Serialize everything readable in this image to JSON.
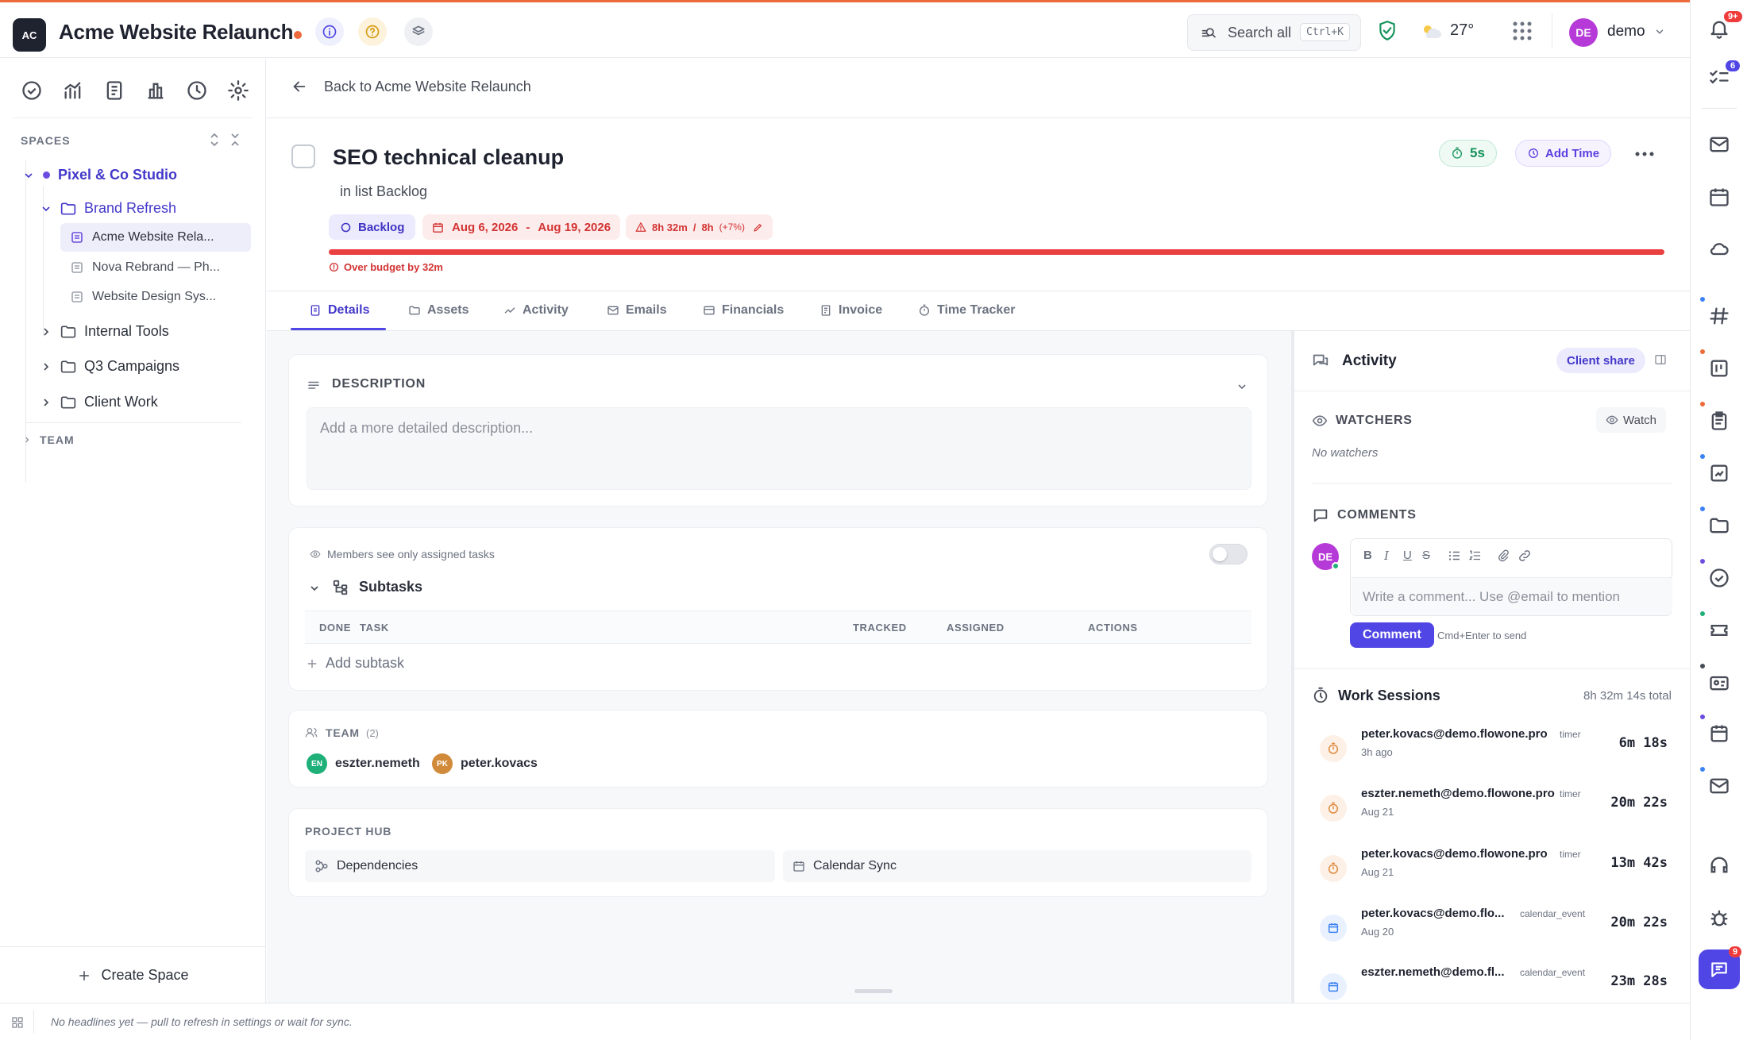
{
  "app": {
    "logo_initials": "AC",
    "project_title": "Acme Website Relaunch",
    "search_label": "Search all",
    "search_shortcut": "Ctrl+K",
    "weather_temp": "27°",
    "user_initials": "DE",
    "user_name": "demo",
    "notification_count": "9+",
    "tasks_count": "6",
    "chat_count": "9",
    "accent_color": "#4f46e5",
    "brand_orange": "#ef6a3a"
  },
  "sidebar": {
    "spaces_label": "SPACES",
    "space_name": "Pixel & Co Studio",
    "folder_open": "Brand Refresh",
    "lists": [
      "Acme Website Rela...",
      "Nova Rebrand — Ph...",
      "Website Design Sys..."
    ],
    "folders": [
      "Internal Tools",
      "Q3 Campaigns",
      "Client Work"
    ],
    "team_label": "TEAM",
    "create_space": "Create Space"
  },
  "task": {
    "back_label": "Back to Acme Website Relaunch",
    "title": "SEO technical cleanup",
    "list_label": "in list Backlog",
    "timer": "5s",
    "add_time": "Add Time",
    "status": "Backlog",
    "date_start": "Aug 6, 2026",
    "date_sep": "-",
    "date_end": "Aug 19, 2026",
    "time_spent": "8h 32m",
    "time_sep": "/",
    "time_estimate": "8h",
    "time_over_pct": "(+7%)",
    "budget_fill": 1.0,
    "over_budget": "Over budget by 32m"
  },
  "tabs": [
    "Details",
    "Assets",
    "Activity",
    "Emails",
    "Financials",
    "Invoice",
    "Time Tracker"
  ],
  "description": {
    "heading": "DESCRIPTION",
    "placeholder": "Add a more detailed description..."
  },
  "subtasks": {
    "visibility_note": "Members see only assigned tasks",
    "title": "Subtasks",
    "columns": [
      "DONE",
      "TASK",
      "TRACKED",
      "ASSIGNED",
      "ACTIONS"
    ],
    "add_label": "Add subtask"
  },
  "team": {
    "heading": "TEAM",
    "count": "(2)",
    "members": [
      {
        "initials": "EN",
        "name": "eszter.nemeth",
        "color": "#1fb07a"
      },
      {
        "initials": "PK",
        "name": "peter.kovacs",
        "color": "#d08a3a"
      }
    ]
  },
  "project_hub": {
    "heading": "PROJECT HUB",
    "items": [
      "Dependencies",
      "Calendar Sync"
    ]
  },
  "activity_panel": {
    "title": "Activity",
    "client_share": "Client share",
    "watchers_label": "WATCHERS",
    "watch_button": "Watch",
    "no_watchers": "No watchers",
    "comments_label": "COMMENTS",
    "commenter_initials": "DE",
    "comment_placeholder": "Write a comment... Use @email to mention",
    "comment_button": "Comment",
    "send_hint": "Cmd+Enter to send",
    "work_sessions_title": "Work Sessions",
    "work_sessions_total": "8h 32m 14s total",
    "sessions": [
      {
        "email": "peter.kovacs@demo.flowone.pro",
        "type": "timer",
        "date": "3h ago",
        "duration": "6m 18s"
      },
      {
        "email": "eszter.nemeth@demo.flowone.pro",
        "type": "timer",
        "date": "Aug 21",
        "duration": "20m 22s"
      },
      {
        "email": "peter.kovacs@demo.flowone.pro",
        "type": "timer",
        "date": "Aug 21",
        "duration": "13m 42s"
      },
      {
        "email": "peter.kovacs@demo.flo...",
        "type": "calendar_event",
        "date": "Aug 20",
        "duration": "20m 22s"
      },
      {
        "email": "eszter.nemeth@demo.fl...",
        "type": "calendar_event",
        "date": "",
        "duration": "23m 28s"
      }
    ]
  },
  "footer": {
    "headline": "No headlines yet — pull to refresh in settings or wait for sync."
  }
}
